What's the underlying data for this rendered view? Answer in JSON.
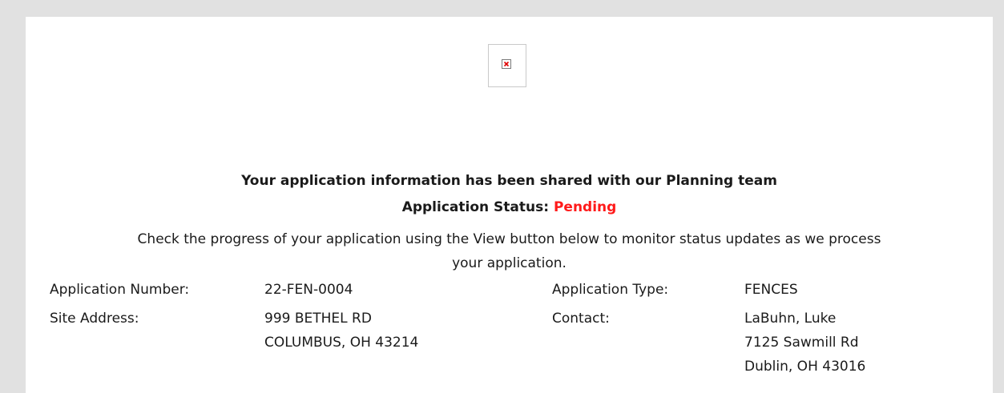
{
  "headline": "Your application information has been shared with our Planning team",
  "status": {
    "label": "Application Status:",
    "value": "Pending",
    "value_color": "#ff1a1a"
  },
  "progress_note_line1": "Check the progress of your application using the View button below to monitor status updates as we process",
  "progress_note_line2": "your application.",
  "image_placeholder_icon": "broken-image-icon",
  "details": {
    "application_number": {
      "label": "Application Number:",
      "value": "22-FEN-0004"
    },
    "application_type": {
      "label": "Application Type:",
      "value": "FENCES"
    },
    "site_address": {
      "label": "Site Address:",
      "lines": [
        "999 BETHEL RD",
        "COLUMBUS, OH 43214"
      ]
    },
    "contact": {
      "label": "Contact:",
      "lines": [
        "LaBuhn, Luke",
        "7125 Sawmill Rd",
        "Dublin, OH 43016"
      ]
    }
  }
}
